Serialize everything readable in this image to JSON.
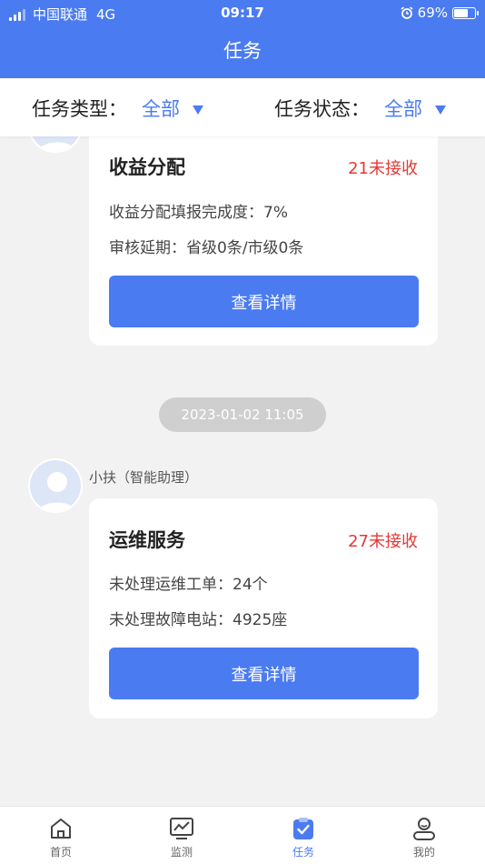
{
  "status_bar": {
    "carrier": "中国联通",
    "network": "4G",
    "time": "09:17",
    "battery": "69%",
    "battery_level": 0.69
  },
  "header": {
    "title": "任务"
  },
  "filters": [
    {
      "label": "任务类型：",
      "value": "全部"
    },
    {
      "label": "任务状态：",
      "value": "全部"
    }
  ],
  "messages": [
    {
      "card": {
        "title": "收益分配",
        "badge": "21未接收",
        "lines": [
          "收益分配填报完成度：7%",
          "审核延期：省级0条/市级0条"
        ],
        "button": "查看详情"
      }
    },
    {
      "timestamp": "2023-01-02 11:05",
      "sender": "小扶（智能助理）",
      "card": {
        "title": "运维服务",
        "badge": "27未接收",
        "lines": [
          "未处理运维工单：24个",
          "未处理故障电站：4925座"
        ],
        "button": "查看详情"
      }
    }
  ],
  "tabbar": {
    "active": "任务",
    "items": [
      {
        "label": "首页",
        "icon": "home-icon"
      },
      {
        "label": "监测",
        "icon": "monitor-icon"
      },
      {
        "label": "任务",
        "icon": "task-icon"
      },
      {
        "label": "我的",
        "icon": "profile-icon"
      }
    ]
  },
  "colors": {
    "primary": "#4a7bf0",
    "alert": "#e53935",
    "background": "#f2f2f2"
  }
}
